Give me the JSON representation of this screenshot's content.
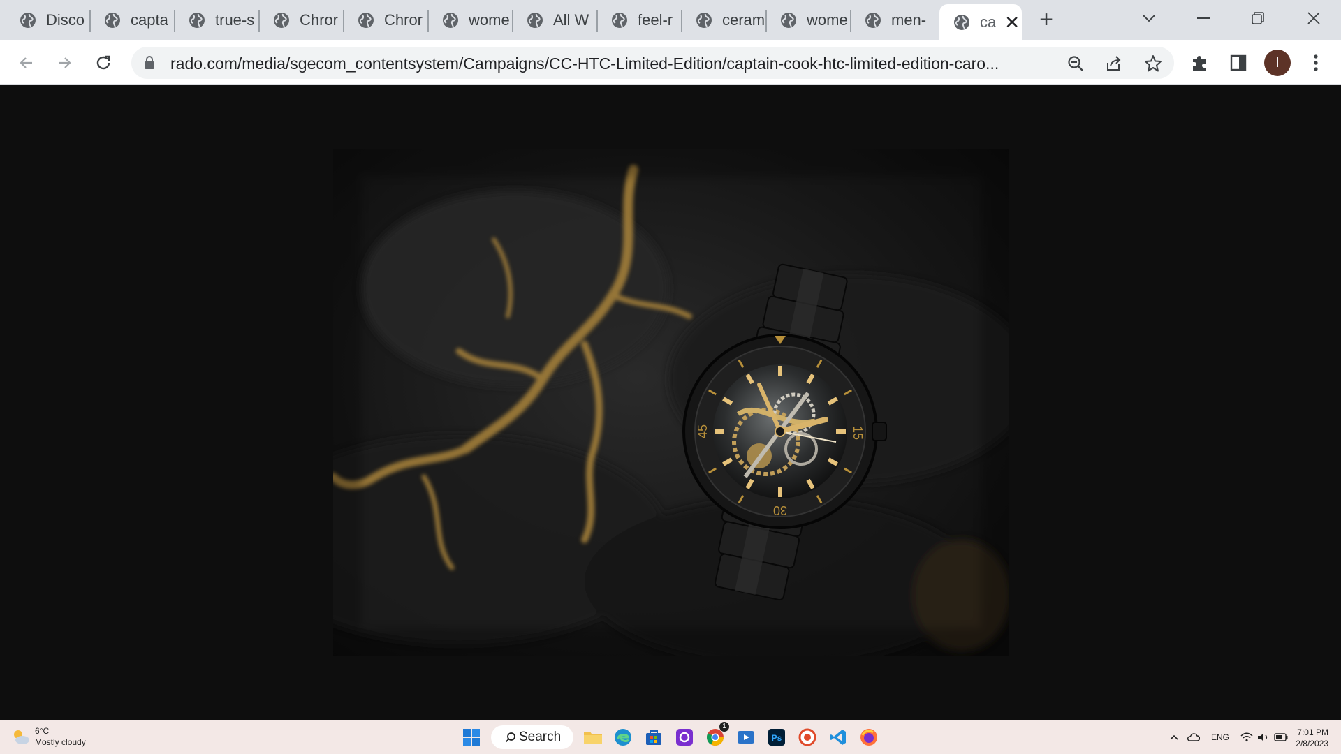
{
  "browser": {
    "tabs": [
      {
        "title": "Disco"
      },
      {
        "title": "capta"
      },
      {
        "title": "true-s"
      },
      {
        "title": "Chror"
      },
      {
        "title": "Chror"
      },
      {
        "title": "wome"
      },
      {
        "title": "All W"
      },
      {
        "title": "feel-r"
      },
      {
        "title": "ceram"
      },
      {
        "title": "wome"
      },
      {
        "title": "men-"
      },
      {
        "title": "ca",
        "active": true
      }
    ],
    "new_tab_label": "+",
    "url": "rado.com/media/sgecom_contentsystem/Campaigns/CC-HTC-Limited-Edition/captain-cook-htc-limited-edition-caro...",
    "profile_initial": "I",
    "icons": [
      "back-arrow-icon",
      "forward-arrow-icon",
      "reload-icon",
      "lock-icon",
      "zoom-icon",
      "share-icon",
      "bookmark-star-icon",
      "extensions-puzzle-icon",
      "side-panel-icon",
      "kebab-menu-icon"
    ]
  },
  "photo": {
    "bezel_numbers": [
      "45",
      "15",
      "30"
    ],
    "colors": {
      "background": "#0e0e0e",
      "rock": "#1c1c1c",
      "gold": "#b8903a"
    }
  },
  "taskbar": {
    "weather": {
      "temp": "6°C",
      "condition": "Mostly cloudy"
    },
    "search_label": "Search",
    "language": "ENG",
    "time": "7:01 PM",
    "date": "2/8/2023",
    "chrome_badge": "1"
  }
}
